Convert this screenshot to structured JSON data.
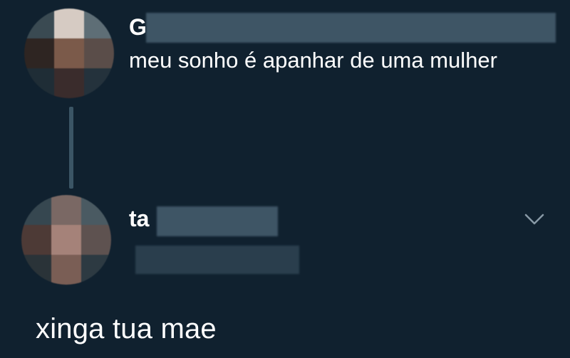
{
  "thread": {
    "original_tweet": {
      "author_initial": "G",
      "text": "meu sonho é apanhar de uma mulher",
      "avatar_icon": "pixelated-avatar-icon"
    },
    "reply": {
      "author_initial": "ta",
      "text": "xinga tua mae",
      "avatar_icon": "pixelated-avatar-icon",
      "menu_icon": "chevron-down-icon"
    }
  },
  "colors": {
    "background": "#10212f",
    "text": "#ffffff",
    "thread_line": "#3b5565",
    "chevron": "#8899a6"
  }
}
